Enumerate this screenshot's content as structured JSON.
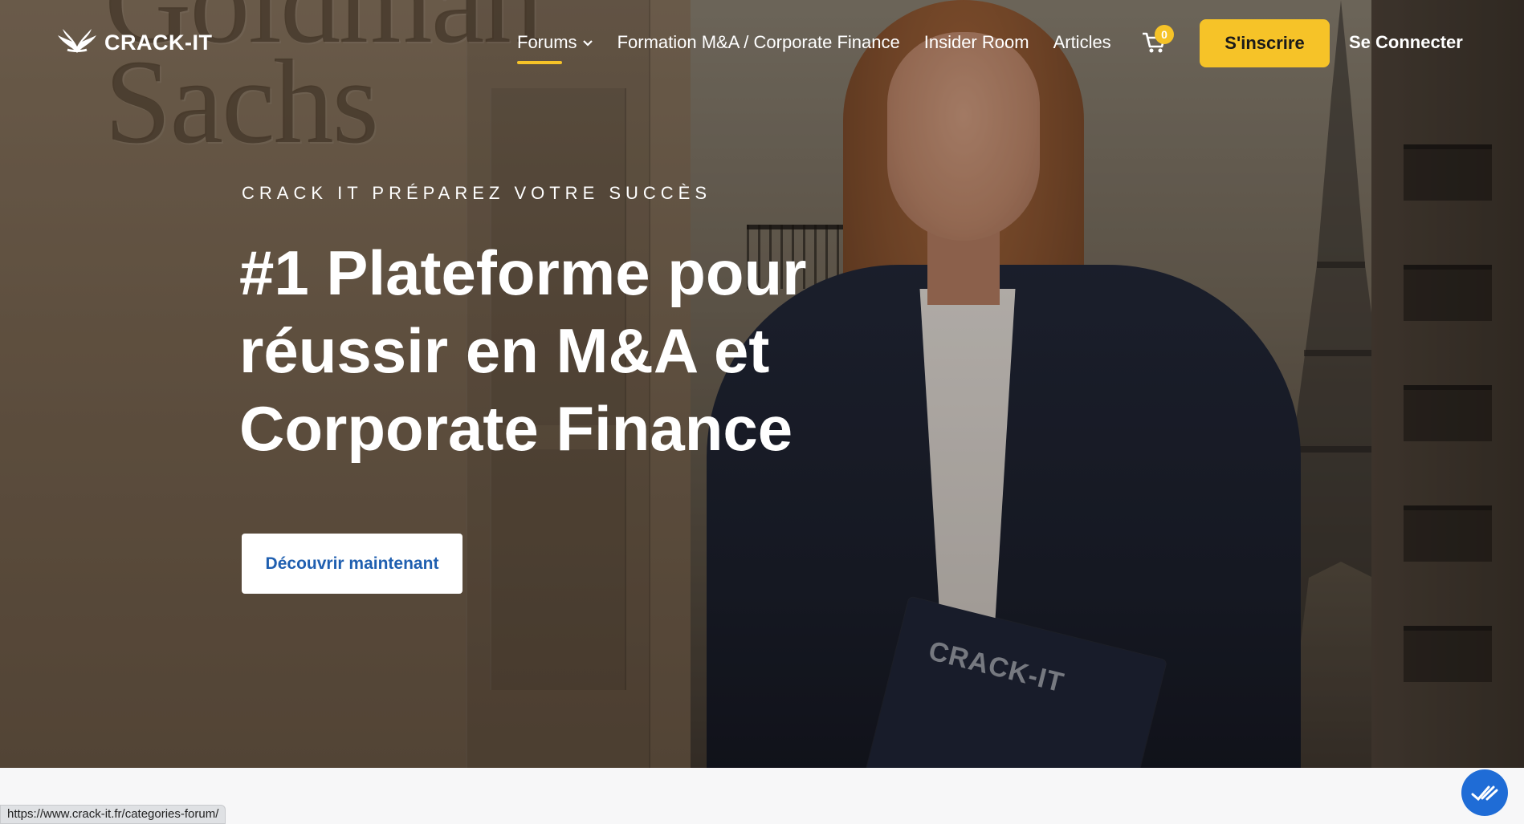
{
  "nav": {
    "logo_text": "CRACK-IT",
    "menu": [
      {
        "label": "Forums",
        "has_dropdown": true,
        "active": true
      },
      {
        "label": "Formation M&A / Corporate Finance"
      },
      {
        "label": "Insider Room"
      },
      {
        "label": "Articles"
      }
    ],
    "cart_count": "0",
    "signup_label": "S'inscrire",
    "login_label": "Se Connecter"
  },
  "hero": {
    "eyebrow": "CRACK IT PRÉPAREZ VOTRE SUCCÈS",
    "headline": "#1 Plateforme pour réussir en M&A et Corporate Finance",
    "cta_label": "Découvrir maintenant",
    "background_engraving": "Goldman Sachs",
    "folder_logo": "CRACK-IT"
  },
  "status_bar": {
    "url": "https://www.crack-it.fr/categories-forum/"
  },
  "colors": {
    "accent": "#f6c328",
    "cta_text": "#1f5fb0",
    "chat": "#1f6cd6"
  },
  "icons": {
    "logo": "eagle-wings-icon",
    "cart": "shopping-cart-icon",
    "dropdown": "chevron-down-icon",
    "chat": "chat-icon"
  }
}
